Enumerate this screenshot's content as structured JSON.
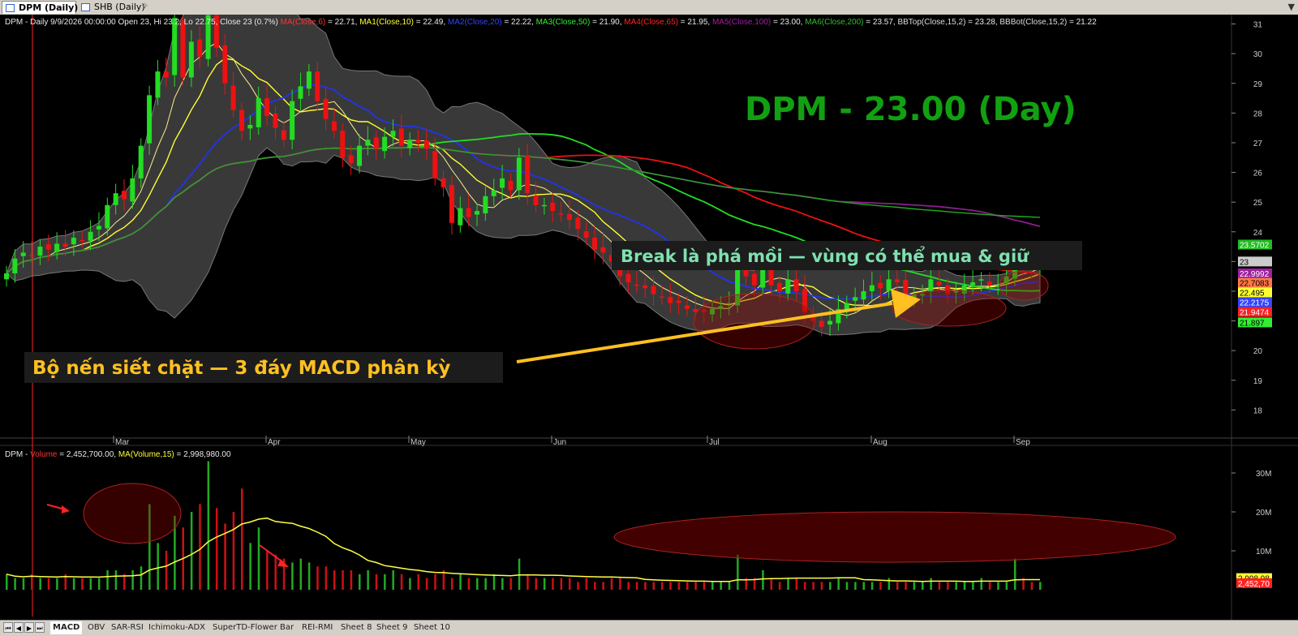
{
  "tabs": [
    {
      "label": "DPM (Daily)",
      "active": true
    },
    {
      "label": "SHB (Daily)",
      "active": false
    }
  ],
  "window_controls": "▼",
  "price_info": {
    "prefix": "DPM - Daily 9/9/2026 00:00:00 Open 23, Hi 23.2, Lo 22.75, Close 23 (0.7%)",
    "indicators": [
      {
        "label": "MA(Close,6)",
        "value": " = 22.71, ",
        "color": "#ff3333"
      },
      {
        "label": "MA1(Close,10)",
        "value": " = 22.49, ",
        "color": "#ffff33"
      },
      {
        "label": "MA2(Close,20)",
        "value": " = 22.22, ",
        "color": "#3344ff"
      },
      {
        "label": "MA3(Close,50)",
        "value": " = 21.90, ",
        "color": "#33ee33"
      },
      {
        "label": "MA4(Close,65)",
        "value": " = 21.95, ",
        "color": "#ff2222"
      },
      {
        "label": "MA5(Close,100)",
        "value": " = 23.00, ",
        "color": "#a020a0"
      },
      {
        "label": "MA6(Close,200)",
        "value": " = 23.57, ",
        "color": "#33bb33"
      },
      {
        "label": "BBTop(Close,15,2)",
        "value": " = 23.28, ",
        "color": "#dddddd"
      },
      {
        "label": "BBBot(Close,15,2)",
        "value": " = 21.22",
        "color": "#dddddd"
      }
    ]
  },
  "volume_info": {
    "prefix": "DPM - ",
    "vol_label": "Volume",
    "vol_value": " = 2,452,700.00, ",
    "ma_label": "MA(Volume,15)",
    "ma_value": " = 2,998,980.00"
  },
  "title_overlay": "DPM - 23.00 (Day)",
  "annotation_1": "Break là phá mồi — vùng có thể mua & giữ",
  "annotation_2": "Bộ nến siết chặt — 3 đáy MACD phân kỳ",
  "price_ticks": [
    "31",
    "30",
    "29",
    "28",
    "27",
    "26",
    "25",
    "24",
    "23",
    "22",
    "21",
    "20",
    "19",
    "18"
  ],
  "price_labels": [
    {
      "text": "23.5702",
      "bg": "#22bb22",
      "fg": "#fff",
      "v": 23.57
    },
    {
      "text": "23",
      "bg": "#cccccc",
      "fg": "#000",
      "v": 23.0
    },
    {
      "text": "22.9992",
      "bg": "#a020a0",
      "fg": "#fff",
      "v": 22.6
    },
    {
      "text": "22.7083",
      "bg": "#ff7744",
      "fg": "#000",
      "v": 22.28
    },
    {
      "text": "22.495",
      "bg": "#ffff33",
      "fg": "#000",
      "v": 21.96
    },
    {
      "text": "22.2175",
      "bg": "#3344ff",
      "fg": "#fff",
      "v": 21.63
    },
    {
      "text": "21.9474",
      "bg": "#ff2222",
      "fg": "#fff",
      "v": 21.3
    },
    {
      "text": "21.897",
      "bg": "#33ee33",
      "fg": "#000",
      "v": 20.95
    }
  ],
  "volume_ticks": [
    "30M",
    "20M",
    "10M"
  ],
  "volume_labels": [
    {
      "text": "2,998,98",
      "bg": "#ffff33",
      "fg": "#000"
    },
    {
      "text": "2,452,70",
      "bg": "#ff2222",
      "fg": "#fff"
    }
  ],
  "months": [
    "Mar",
    "Apr",
    "May",
    "Jun",
    "Jul",
    "Aug",
    "Sep"
  ],
  "sheet_tabs": [
    "MACD",
    "OBV",
    "SAR-RSI",
    "Ichimoku-ADX",
    "SuperTD-Flower",
    "Bar",
    "REI-RMI",
    "Sheet 8",
    "Sheet 9",
    "Sheet 10"
  ],
  "nav_buttons": [
    "⏮",
    "◀",
    "▶",
    "⏭"
  ],
  "chart_data": {
    "type": "candlestick",
    "price_range": [
      17.6,
      31.6
    ],
    "volume_range": [
      0,
      35
    ],
    "closes": [
      22.6,
      23.1,
      23.3,
      23.2,
      23.5,
      23.4,
      23.6,
      23.5,
      23.8,
      23.7,
      24.0,
      24.2,
      24.9,
      25.3,
      25.1,
      25.8,
      26.9,
      28.6,
      29.4,
      29.2,
      31.2,
      29.2,
      30.4,
      29.9,
      31.3,
      30.2,
      29.0,
      28.1,
      27.4,
      27.6,
      28.5,
      27.9,
      27.5,
      27.1,
      28.4,
      28.9,
      29.4,
      28.4,
      27.8,
      27.4,
      26.5,
      26.3,
      26.9,
      27.1,
      26.8,
      27.2,
      27.4,
      26.9,
      27.1,
      27.0,
      26.8,
      25.8,
      25.5,
      24.3,
      24.8,
      24.5,
      24.7,
      25.2,
      25.4,
      25.8,
      25.4,
      26.5,
      25.3,
      24.9,
      24.9,
      24.7,
      24.6,
      24.4,
      24.1,
      23.8,
      23.4,
      23.3,
      23.0,
      22.5,
      22.3,
      22.2,
      22.1,
      21.9,
      21.8,
      21.6,
      21.6,
      21.4,
      21.3,
      21.3,
      21.4,
      21.5,
      21.6,
      22.8,
      22.5,
      22.2,
      23.0,
      22.2,
      22.0,
      22.4,
      22.0,
      21.3,
      21.0,
      20.8,
      21.0,
      21.4,
      21.6,
      21.8,
      22.0,
      22.2,
      22.1,
      22.4,
      22.3,
      21.8,
      21.9,
      21.9,
      22.4,
      22.2,
      21.9,
      22.0,
      22.2,
      22.3,
      22.4,
      22.2,
      22.2,
      22.5,
      23.3,
      22.9,
      22.8,
      23.0
    ],
    "volumes_m": [
      4,
      3,
      3,
      4,
      3,
      3,
      3,
      4,
      3,
      3,
      3,
      3,
      5,
      5,
      4,
      5,
      6,
      22,
      12,
      10,
      19,
      16,
      20,
      22,
      33,
      21,
      17,
      20,
      26,
      12,
      16,
      10,
      9,
      8,
      7,
      8,
      7,
      6,
      6,
      5,
      5,
      5,
      4,
      5,
      4,
      4,
      5,
      4,
      3,
      4,
      3,
      4,
      5,
      3,
      4,
      3,
      3,
      3,
      4,
      3,
      3,
      8,
      4,
      3,
      3,
      3,
      3,
      3,
      2,
      3,
      2,
      2,
      3,
      3,
      2,
      2,
      2,
      2,
      2,
      2,
      2,
      2,
      2,
      2,
      2,
      2,
      2,
      9,
      3,
      3,
      5,
      3,
      2,
      3,
      3,
      2,
      2,
      2,
      2,
      3,
      2,
      2,
      2,
      2,
      2,
      3,
      2,
      2,
      2,
      2,
      3,
      2,
      2,
      2,
      2,
      2,
      3,
      2,
      2,
      2,
      8,
      3,
      2,
      2
    ]
  }
}
